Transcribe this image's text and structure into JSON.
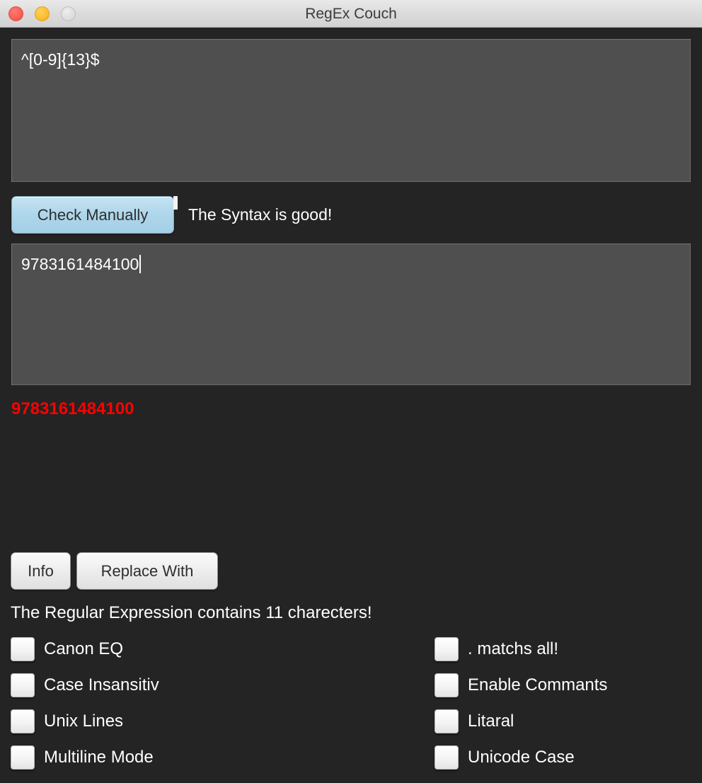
{
  "window": {
    "title": "RegEx Couch",
    "controls": [
      {
        "name": "close",
        "color": "#fa5d55"
      },
      {
        "name": "minimize",
        "color": "#fdbc2d"
      },
      {
        "name": "zoom",
        "color": "#dedede"
      }
    ]
  },
  "regex_input": {
    "value": "^[0-9]{13}$",
    "placeholder": ""
  },
  "actions": {
    "check_manually_label": "Check Manually",
    "info_label": "Info",
    "replace_with_label": "Replace With"
  },
  "status": {
    "syntax": "The Syntax is good!",
    "char_count": "The Regular Expression contains 11 charecters!"
  },
  "test_input": {
    "value": "9783161484100",
    "placeholder": ""
  },
  "match_result": {
    "text": "9783161484100",
    "color": "#ff0000"
  },
  "options": {
    "left": [
      {
        "label": "Canon EQ",
        "checked": false
      },
      {
        "label": "Case Insansitiv",
        "checked": false
      },
      {
        "label": "Unix Lines",
        "checked": false
      },
      {
        "label": "Multiline Mode",
        "checked": false
      }
    ],
    "right": [
      {
        "label": ". matchs all!",
        "checked": false
      },
      {
        "label": "Enable Commants",
        "checked": false
      },
      {
        "label": "Litaral",
        "checked": false
      },
      {
        "label": "Unicode Case",
        "checked": false
      }
    ]
  },
  "colors": {
    "window_background": "#242424",
    "field_background": "#4f4f4f",
    "accent_button": "#aed6ea",
    "match_highlight": "#ff0000"
  }
}
